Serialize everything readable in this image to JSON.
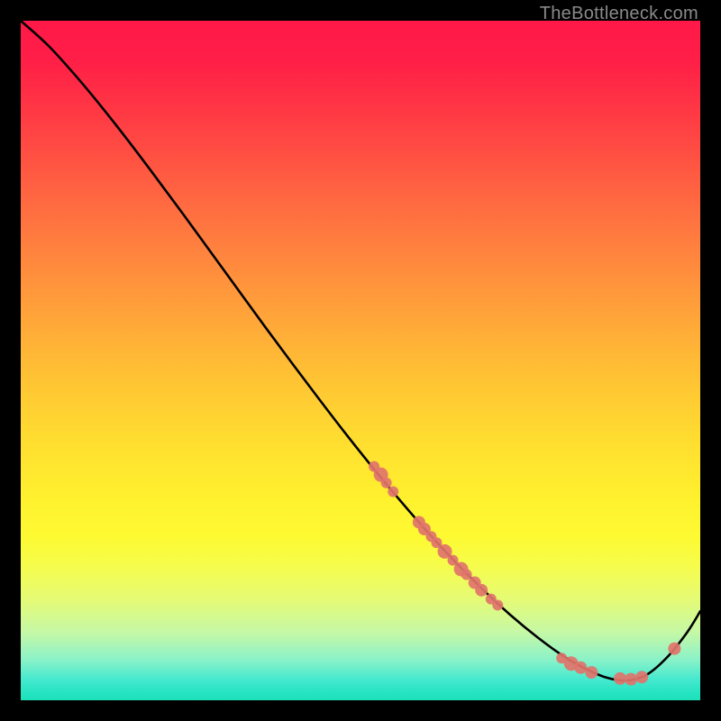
{
  "watermark": "TheBottleneck.com",
  "chart_data": {
    "type": "line",
    "title": "",
    "xlabel": "",
    "ylabel": "",
    "xlim": [
      0,
      1
    ],
    "ylim": [
      0,
      1
    ],
    "grid": false,
    "series": [
      {
        "name": "bottleneck-curve",
        "x": [
          0.0,
          0.04,
          0.08,
          0.12,
          0.16,
          0.2,
          0.24,
          0.28,
          0.32,
          0.36,
          0.4,
          0.44,
          0.48,
          0.52,
          0.56,
          0.6,
          0.64,
          0.68,
          0.72,
          0.76,
          0.8,
          0.83,
          0.86,
          0.89,
          0.92,
          0.95,
          0.98,
          1.0
        ],
        "y": [
          1.0,
          0.964,
          0.92,
          0.872,
          0.821,
          0.768,
          0.714,
          0.659,
          0.604,
          0.549,
          0.495,
          0.442,
          0.39,
          0.34,
          0.292,
          0.246,
          0.203,
          0.163,
          0.126,
          0.093,
          0.064,
          0.047,
          0.034,
          0.029,
          0.037,
          0.062,
          0.099,
          0.131
        ]
      }
    ],
    "scatter_points": {
      "name": "markers",
      "color": "#e1746b",
      "points": [
        {
          "x": 0.52,
          "y": 0.344,
          "r": 6
        },
        {
          "x": 0.53,
          "y": 0.332,
          "r": 8
        },
        {
          "x": 0.538,
          "y": 0.32,
          "r": 6
        },
        {
          "x": 0.548,
          "y": 0.307,
          "r": 6
        },
        {
          "x": 0.586,
          "y": 0.262,
          "r": 7
        },
        {
          "x": 0.594,
          "y": 0.252,
          "r": 7
        },
        {
          "x": 0.604,
          "y": 0.241,
          "r": 6
        },
        {
          "x": 0.612,
          "y": 0.232,
          "r": 6
        },
        {
          "x": 0.624,
          "y": 0.219,
          "r": 8
        },
        {
          "x": 0.636,
          "y": 0.206,
          "r": 6
        },
        {
          "x": 0.648,
          "y": 0.193,
          "r": 8
        },
        {
          "x": 0.656,
          "y": 0.185,
          "r": 6
        },
        {
          "x": 0.668,
          "y": 0.173,
          "r": 7
        },
        {
          "x": 0.678,
          "y": 0.162,
          "r": 7
        },
        {
          "x": 0.692,
          "y": 0.149,
          "r": 6
        },
        {
          "x": 0.702,
          "y": 0.14,
          "r": 6
        },
        {
          "x": 0.796,
          "y": 0.062,
          "r": 6
        },
        {
          "x": 0.81,
          "y": 0.054,
          "r": 8
        },
        {
          "x": 0.824,
          "y": 0.048,
          "r": 7
        },
        {
          "x": 0.84,
          "y": 0.041,
          "r": 7
        },
        {
          "x": 0.882,
          "y": 0.032,
          "r": 7
        },
        {
          "x": 0.898,
          "y": 0.031,
          "r": 7
        },
        {
          "x": 0.914,
          "y": 0.034,
          "r": 7
        },
        {
          "x": 0.962,
          "y": 0.076,
          "r": 7
        }
      ]
    },
    "background_gradient": {
      "top_color": "#ff1848",
      "mid_color": "#ffde30",
      "bottom_color": "#1ee1b9"
    }
  }
}
